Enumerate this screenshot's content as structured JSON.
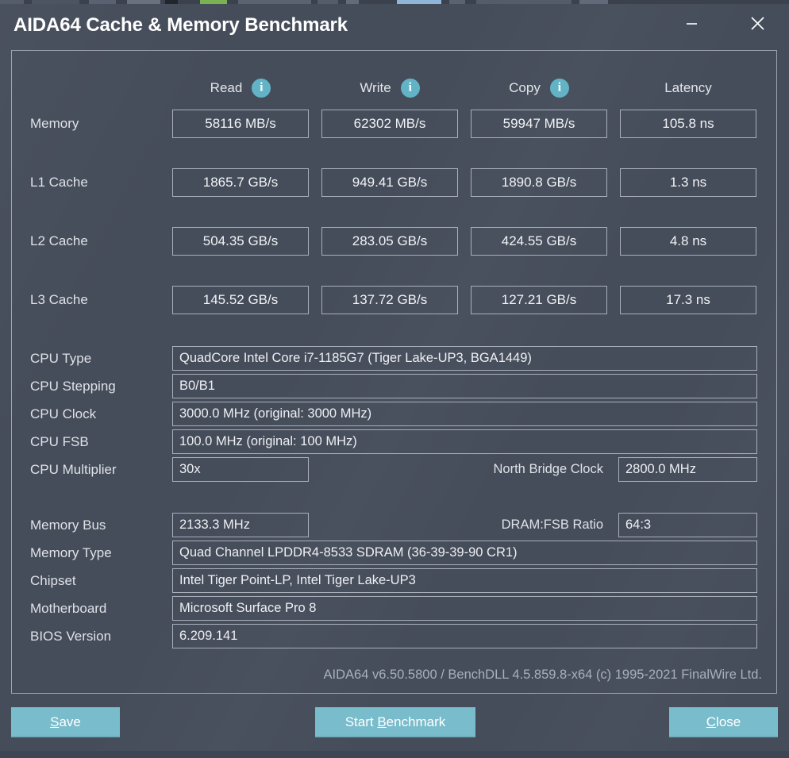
{
  "window": {
    "title": "AIDA64 Cache & Memory Benchmark",
    "minimize_label": "Minimize",
    "close_label": "Close"
  },
  "colors": {
    "background": "#454c5a",
    "panel_border": "#9fa6b2",
    "accent_button": "#79bccb",
    "info_icon": "#63b3c6",
    "text": "#e9ebee",
    "muted_text": "#a9b0bb"
  },
  "benchmark": {
    "columns": [
      {
        "label": "Read",
        "has_info": true
      },
      {
        "label": "Write",
        "has_info": true
      },
      {
        "label": "Copy",
        "has_info": true
      },
      {
        "label": "Latency",
        "has_info": false
      }
    ],
    "rows": [
      {
        "label": "Memory",
        "read": "58116 MB/s",
        "write": "62302 MB/s",
        "copy": "59947 MB/s",
        "latency": "105.8 ns"
      },
      {
        "label": "L1 Cache",
        "read": "1865.7 GB/s",
        "write": "949.41 GB/s",
        "copy": "1890.8 GB/s",
        "latency": "1.3 ns"
      },
      {
        "label": "L2 Cache",
        "read": "504.35 GB/s",
        "write": "283.05 GB/s",
        "copy": "424.55 GB/s",
        "latency": "4.8 ns"
      },
      {
        "label": "L3 Cache",
        "read": "145.52 GB/s",
        "write": "137.72 GB/s",
        "copy": "127.21 GB/s",
        "latency": "17.3 ns"
      }
    ]
  },
  "cpu_info": {
    "type_label": "CPU Type",
    "type_value": "QuadCore Intel Core i7-1185G7  (Tiger Lake-UP3, BGA1449)",
    "stepping_label": "CPU Stepping",
    "stepping_value": "B0/B1",
    "clock_label": "CPU Clock",
    "clock_value": "3000.0 MHz  (original: 3000 MHz)",
    "fsb_label": "CPU FSB",
    "fsb_value": "100.0 MHz  (original: 100 MHz)",
    "multiplier_label": "CPU Multiplier",
    "multiplier_value": "30x",
    "north_bridge_label": "North Bridge Clock",
    "north_bridge_value": "2800.0 MHz"
  },
  "system_info": {
    "memory_bus_label": "Memory Bus",
    "memory_bus_value": "2133.3 MHz",
    "dram_fsb_label": "DRAM:FSB Ratio",
    "dram_fsb_value": "64:3",
    "memory_type_label": "Memory Type",
    "memory_type_value": "Quad Channel LPDDR4-8533 SDRAM  (36-39-39-90 CR1)",
    "chipset_label": "Chipset",
    "chipset_value": "Intel Tiger Point-LP, Intel Tiger Lake-UP3",
    "motherboard_label": "Motherboard",
    "motherboard_value": "Microsoft Surface Pro 8",
    "bios_label": "BIOS Version",
    "bios_value": "6.209.141"
  },
  "footer": {
    "version_text": "AIDA64 v6.50.5800 / BenchDLL 4.5.859.8-x64  (c) 1995-2021 FinalWire Ltd."
  },
  "buttons": {
    "save": {
      "prefix": "",
      "accel": "S",
      "suffix": "ave"
    },
    "start": {
      "prefix": "Start ",
      "accel": "B",
      "suffix": "enchmark"
    },
    "close": {
      "prefix": "",
      "accel": "C",
      "suffix": "lose"
    }
  }
}
